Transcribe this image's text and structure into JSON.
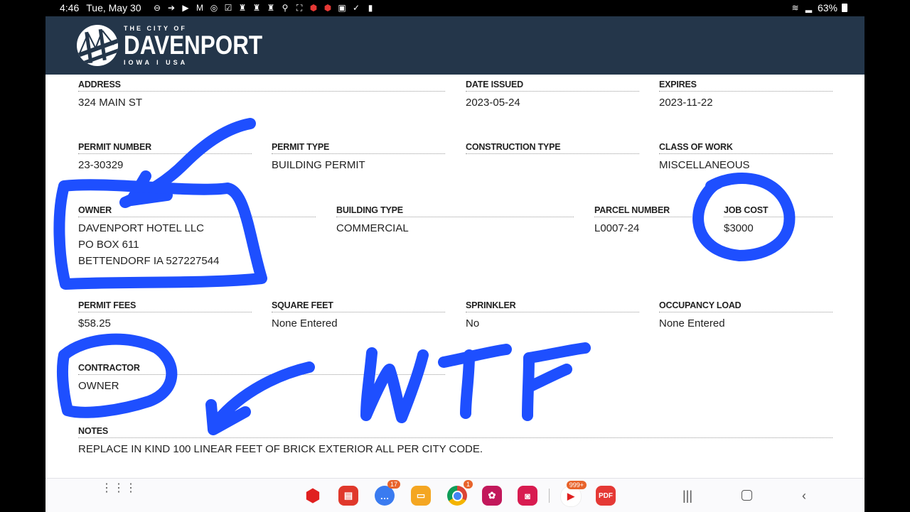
{
  "status_bar": {
    "time": "4:46",
    "date": "Tue, May 30",
    "battery": "63%"
  },
  "header": {
    "logo_top": "THE CITY OF",
    "logo_main": "DAVENPORT",
    "logo_bottom": "IOWA I USA"
  },
  "permit": {
    "address": {
      "label": "ADDRESS",
      "value": "324 MAIN ST"
    },
    "date_issued": {
      "label": "DATE ISSUED",
      "value": "2023-05-24"
    },
    "expires": {
      "label": "EXPIRES",
      "value": "2023-11-22"
    },
    "permit_number": {
      "label": "PERMIT NUMBER",
      "value": "23-30329"
    },
    "permit_type": {
      "label": "PERMIT TYPE",
      "value": "BUILDING PERMIT"
    },
    "construction_type": {
      "label": "CONSTRUCTION TYPE",
      "value": ""
    },
    "class_of_work": {
      "label": "CLASS OF WORK",
      "value": "MISCELLANEOUS"
    },
    "owner": {
      "label": "OWNER",
      "lines": [
        "DAVENPORT HOTEL LLC",
        "PO BOX 611",
        "BETTENDORF IA 527227544"
      ]
    },
    "building_type": {
      "label": "BUILDING TYPE",
      "value": "COMMERCIAL"
    },
    "parcel_number": {
      "label": "PARCEL NUMBER",
      "value": "L0007-24"
    },
    "job_cost": {
      "label": "JOB COST",
      "value": "$3000"
    },
    "permit_fees": {
      "label": "PERMIT FEES",
      "value": "$58.25"
    },
    "square_feet": {
      "label": "SQUARE FEET",
      "value": "None Entered"
    },
    "sprinkler": {
      "label": "SPRINKLER",
      "value": "No"
    },
    "occupancy_load": {
      "label": "OCCUPANCY LOAD",
      "value": "None Entered"
    },
    "contractor": {
      "label": "CONTRACTOR",
      "value": "OWNER"
    },
    "notes": {
      "label": "NOTES",
      "value": "REPLACE IN KIND 100 LINEAR FEET OF BRICK EXTERIOR ALL PER CITY CODE."
    }
  },
  "annotation": {
    "text": "WTF",
    "color": "#1e4fff"
  },
  "taskbar": {
    "badges": {
      "messages": "17",
      "chrome": "1",
      "youtube": "999+"
    },
    "pdf_label": "PDF"
  }
}
